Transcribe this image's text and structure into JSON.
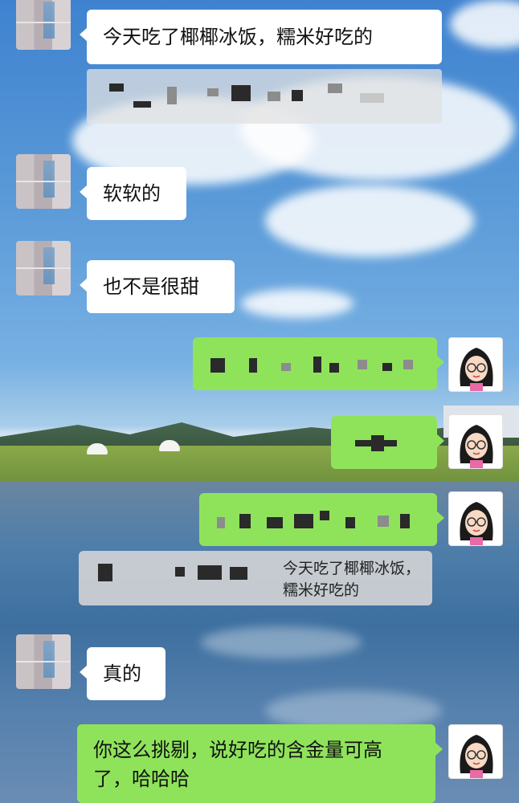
{
  "chat": {
    "m1": "今天吃了椰椰冰饭，糯米好吃的",
    "m2": "软软的",
    "m3": "也不是很甜",
    "quote_text": "今天吃了椰椰冰饭，糯米好吃的",
    "m4": "真的",
    "m5": "你这么挑剔，说好吃的含金量可高了，哈哈哈"
  },
  "colors": {
    "outgoing_bubble": "#8fe35b",
    "incoming_bubble": "#ffffff",
    "quote_bubble": "#d6d6d6"
  },
  "icons": {
    "contact_avatar": "pixelated-avatar",
    "self_avatar": "girl-with-glasses-avatar"
  }
}
